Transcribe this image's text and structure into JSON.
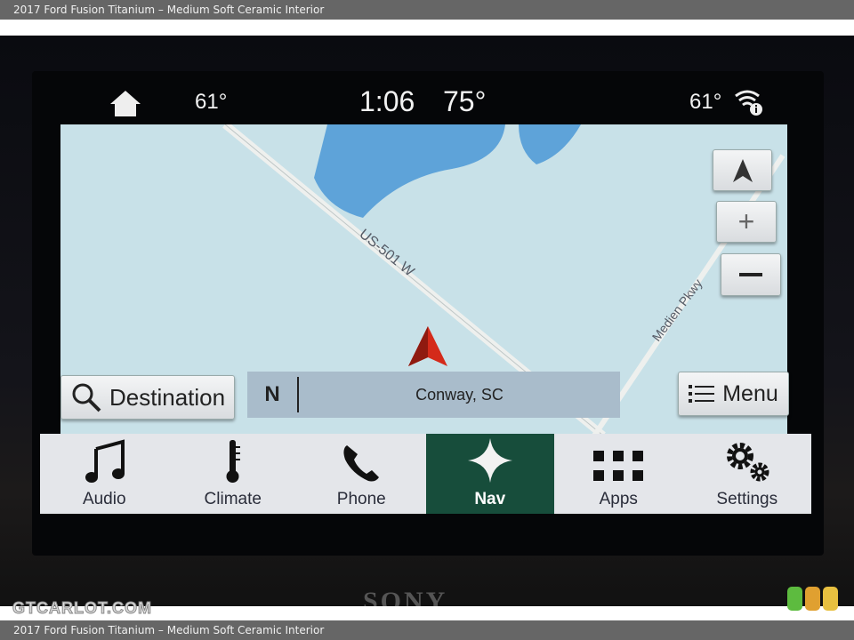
{
  "caption": "2017 Ford Fusion Titanium – Medium Soft Ceramic Interior",
  "status": {
    "left_temp": "61°",
    "time": "1:06",
    "center_temp": "75°",
    "right_temp": "61°"
  },
  "map": {
    "road_main": "US-501 W",
    "road_secondary": "Medien Pkwy",
    "location": "Conway, SC",
    "heading": "N",
    "colors": {
      "land": "#c8e1e8",
      "water": "#5ea3d9",
      "road": "#e8ecec",
      "vehicle": "#d42a1a"
    }
  },
  "buttons": {
    "destination": "Destination",
    "menu": "Menu"
  },
  "nav_tabs": [
    {
      "label": "Audio",
      "icon": "music-note-icon"
    },
    {
      "label": "Climate",
      "icon": "thermometer-icon"
    },
    {
      "label": "Phone",
      "icon": "phone-icon"
    },
    {
      "label": "Nav",
      "icon": "compass-star-icon",
      "active": true
    },
    {
      "label": "Apps",
      "icon": "grid-icon"
    },
    {
      "label": "Settings",
      "icon": "gears-icon"
    }
  ],
  "accent": "#174d3b",
  "brand": "SONY",
  "watermark": "GTCARLOT.COM"
}
